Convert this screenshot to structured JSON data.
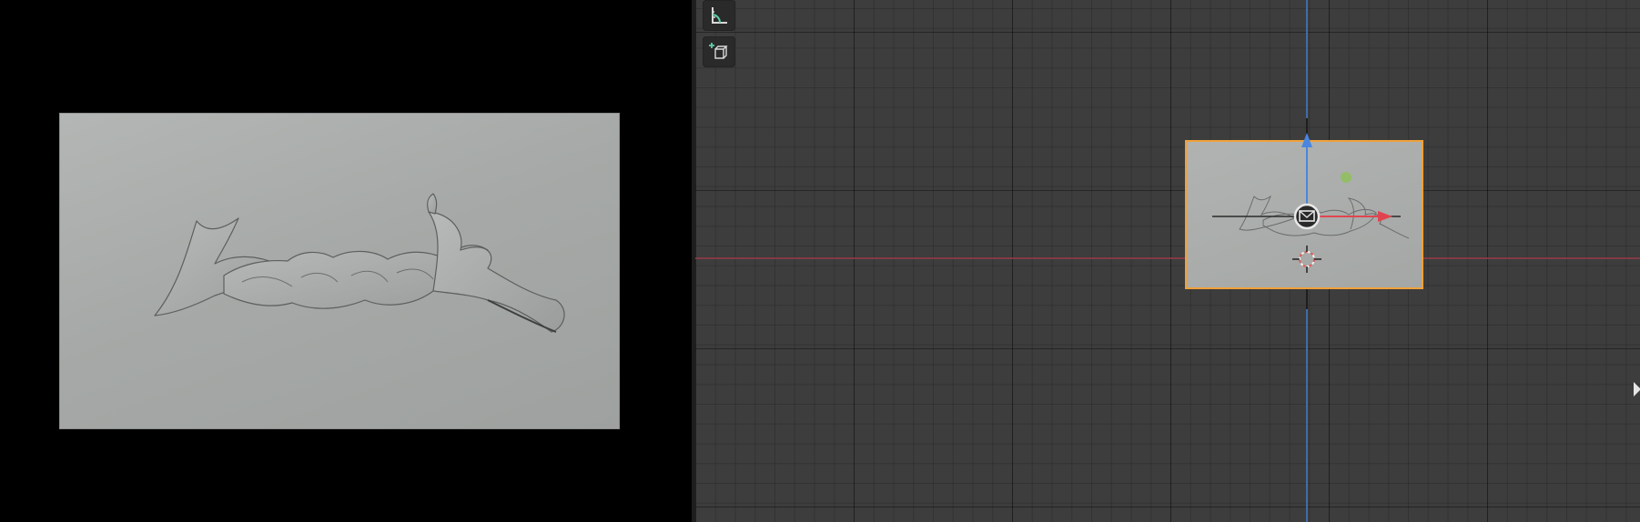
{
  "render_preview": {
    "panel_color": "#a8aba9",
    "artwork_icon": "graffiti-logo-relief"
  },
  "viewport": {
    "background": "#3d3d3d",
    "x_axis_color": "#8a3a46",
    "z_axis_color": "#3f6fb0",
    "selection_color": "#f0a13a",
    "toolbar": [
      {
        "id": "measure",
        "icon": "measure-tool-icon"
      },
      {
        "id": "add-cube",
        "icon": "add-cube-icon"
      }
    ],
    "selected_object": {
      "type": "plane",
      "artwork_icon": "graffiti-logo-relief"
    },
    "gizmo": {
      "icons": [
        "move-gizmo-center-icon",
        "move-arrow-z-icon",
        "move-arrow-x-icon",
        "3d-cursor-icon",
        "light-handle-icon"
      ]
    }
  }
}
